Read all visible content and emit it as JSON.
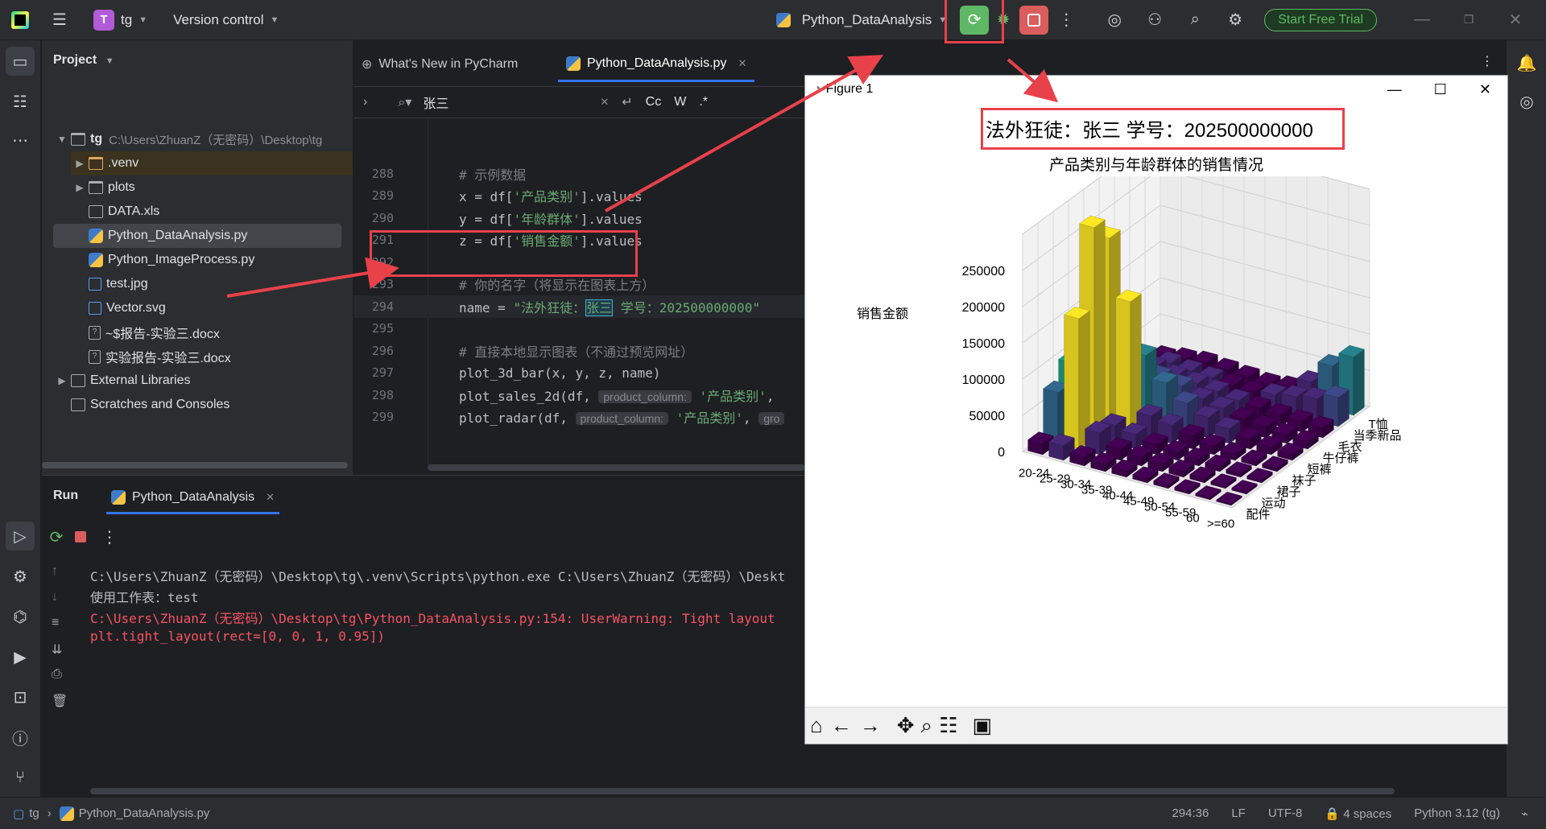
{
  "titlebar": {
    "project_badge": "T",
    "project_name": "tg",
    "version_control": "Version control",
    "run_config": "Python_DataAnalysis",
    "start_trial": "Start Free Trial"
  },
  "project_panel": {
    "header": "Project",
    "tree": [
      {
        "label": "tg",
        "path": "C:\\Users\\ZhuanZ（无密码）\\Desktop\\tg",
        "type": "root"
      },
      {
        "label": ".venv",
        "type": "folder"
      },
      {
        "label": "plots",
        "type": "folder"
      },
      {
        "label": "DATA.xls",
        "type": "table"
      },
      {
        "label": "Python_DataAnalysis.py",
        "type": "python"
      },
      {
        "label": "Python_ImageProcess.py",
        "type": "python"
      },
      {
        "label": "test.jpg",
        "type": "image"
      },
      {
        "label": "Vector.svg",
        "type": "image"
      },
      {
        "label": "~$报告-实验三.docx",
        "type": "doc"
      },
      {
        "label": "实验报告-实验三.docx",
        "type": "doc"
      },
      {
        "label": "External Libraries",
        "type": "lib"
      },
      {
        "label": "Scratches and Consoles",
        "type": "scratch"
      }
    ]
  },
  "editor": {
    "tabs": [
      "What's New in PyCharm",
      "Python_DataAnalysis.py"
    ],
    "search_value": "张三",
    "search_opts": [
      "Cc",
      "W",
      ".*"
    ],
    "lines": [
      {
        "n": "288",
        "parts": [
          [
            "cmt",
            "# 示例数据"
          ]
        ]
      },
      {
        "n": "289",
        "parts": [
          [
            "",
            "x = df["
          ],
          [
            "str",
            "'产品类别'"
          ],
          [
            "",
            "].values"
          ]
        ]
      },
      {
        "n": "290",
        "parts": [
          [
            "",
            "y = df["
          ],
          [
            "str",
            "'年龄群体'"
          ],
          [
            "",
            "].values"
          ]
        ]
      },
      {
        "n": "291",
        "parts": [
          [
            "",
            "z = df["
          ],
          [
            "str",
            "'销售金额'"
          ],
          [
            "",
            "].values"
          ]
        ]
      },
      {
        "n": "292",
        "parts": []
      },
      {
        "n": "293",
        "parts": [
          [
            "cmt",
            "# 你的名字（将显示在图表上方）"
          ]
        ]
      },
      {
        "n": "294",
        "parts": [
          [
            "",
            "name = "
          ],
          [
            "str",
            "\"法外狂徒："
          ],
          [
            "hl",
            "张三"
          ],
          [
            "str",
            " 学号：202500000000\""
          ]
        ]
      },
      {
        "n": "295",
        "parts": []
      },
      {
        "n": "296",
        "parts": [
          [
            "cmt",
            "# 直接本地显示图表（不通过预览网址）"
          ]
        ]
      },
      {
        "n": "297",
        "parts": [
          [
            "",
            "plot_3d_bar(x, y, z, name)"
          ]
        ]
      },
      {
        "n": "298",
        "parts": [
          [
            "",
            "plot_sales_2d(df, "
          ],
          [
            "hint",
            "product_column:"
          ],
          [
            "str",
            " '产品类别'"
          ],
          [
            "",
            ","
          ]
        ]
      },
      {
        "n": "299",
        "parts": [
          [
            "",
            "plot_radar(df, "
          ],
          [
            "hint",
            "product_column:"
          ],
          [
            "str",
            " '产品类别'"
          ],
          [
            "",
            ", "
          ],
          [
            "hint",
            "gro"
          ]
        ]
      }
    ]
  },
  "run_panel": {
    "tab_run": "Run",
    "tab_config": "Python_DataAnalysis",
    "console": [
      {
        "cls": "",
        "text": "C:\\Users\\ZhuanZ（无密码）\\Desktop\\tg\\.venv\\Scripts\\python.exe C:\\Users\\ZhuanZ（无密码）\\Deskt"
      },
      {
        "cls": "",
        "text": "使用工作表：test"
      },
      {
        "cls": "err",
        "text": "C:\\Users\\ZhuanZ（无密码）\\Desktop\\tg\\Python_DataAnalysis.py:154: UserWarning: Tight layout"
      },
      {
        "cls": "err",
        "text": "  plt.tight_layout(rect=[0, 0, 1, 0.95])"
      }
    ]
  },
  "statusbar": {
    "project": "tg",
    "file": "Python_DataAnalysis.py",
    "position": "294:36",
    "line_sep": "LF",
    "encoding": "UTF-8",
    "indent": "4 spaces",
    "interpreter": "Python 3.12 (tg)"
  },
  "figure": {
    "window_title": "Figure 1",
    "suptitle": "法外狂徒：张三 学号：202500000000",
    "title": "产品类别与年龄群体的销售情况"
  },
  "chart_data": {
    "type": "bar",
    "subtype": "3d-bar",
    "title": "产品类别与年龄群体的销售情况",
    "zlabel": "销售金额",
    "zlim": [
      0,
      300000
    ],
    "z_ticks": [
      "0",
      "50000",
      "100000",
      "150000",
      "200000",
      "250000"
    ],
    "age_groups": [
      "20-24",
      "25-29",
      "30-34",
      "35-39",
      "40-44",
      "45-49",
      "50-54",
      "55-59",
      "60",
      ">=60"
    ],
    "product_categories": [
      "配件",
      "运动",
      "裙子",
      "袜子",
      "短裤",
      "牛仔裤",
      "毛衣",
      "当季新品",
      "T恤"
    ],
    "colormap": "viridis",
    "series": [
      {
        "name": "配件",
        "values": [
          15000,
          20000,
          12000,
          10000,
          8000,
          6000,
          5000,
          4000,
          3000,
          2000
        ]
      },
      {
        "name": "运动",
        "values": [
          70000,
          180000,
          30000,
          15000,
          12000,
          10000,
          8000,
          6000,
          4000,
          3000
        ]
      },
      {
        "name": "裙子",
        "values": [
          95000,
          290000,
          25000,
          20000,
          14000,
          11000,
          9000,
          7000,
          5000,
          4000
        ]
      },
      {
        "name": "袜子",
        "values": [
          40000,
          260000,
          180000,
          30000,
          25000,
          18000,
          12000,
          9000,
          6000,
          5000
        ]
      },
      {
        "name": "短裤",
        "values": [
          25000,
          150000,
          90000,
          60000,
          40000,
          28000,
          20000,
          14000,
          10000,
          8000
        ]
      },
      {
        "name": "牛仔裤",
        "values": [
          30000,
          60000,
          45000,
          40000,
          30000,
          25000,
          18000,
          15000,
          12000,
          10000
        ]
      },
      {
        "name": "毛衣",
        "values": [
          20000,
          35000,
          30000,
          28000,
          25000,
          20000,
          18000,
          16000,
          15000,
          14000
        ]
      },
      {
        "name": "当季新品",
        "values": [
          15000,
          25000,
          22000,
          20000,
          18000,
          16000,
          20000,
          25000,
          30000,
          40000
        ]
      },
      {
        "name": "T恤",
        "values": [
          10000,
          15000,
          18000,
          16000,
          14000,
          12000,
          15000,
          30000,
          60000,
          80000
        ]
      }
    ]
  }
}
